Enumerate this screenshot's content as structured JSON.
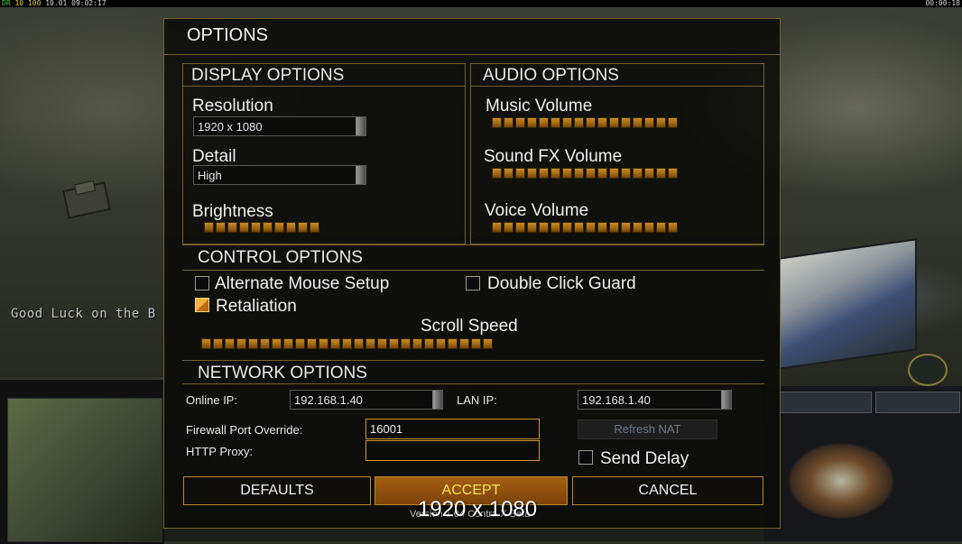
{
  "hud": {
    "fps_parts": [
      "DR",
      "10",
      "100",
      "10.01",
      "09:02:17"
    ],
    "timer": "00:00:18",
    "chat_message": "Good Luck on the B"
  },
  "options": {
    "title": "OPTIONS",
    "display": {
      "title": "DISPLAY OPTIONS",
      "resolution_label": "Resolution",
      "resolution_value": "1920 x 1080",
      "detail_label": "Detail",
      "detail_value": "High",
      "brightness_label": "Brightness",
      "brightness_level": 10
    },
    "audio": {
      "title": "AUDIO OPTIONS",
      "music_label": "Music Volume",
      "music_level": 16,
      "sfx_label": "Sound FX Volume",
      "sfx_level": 16,
      "voice_label": "Voice Volume",
      "voice_level": 16
    },
    "control": {
      "title": "CONTROL OPTIONS",
      "alt_mouse_label": "Alternate Mouse Setup",
      "alt_mouse_checked": false,
      "double_click_label": "Double Click Guard",
      "double_click_checked": false,
      "retaliation_label": "Retaliation",
      "retaliation_checked": true,
      "scroll_speed_label": "Scroll Speed",
      "scroll_speed_level": 25
    },
    "network": {
      "title": "NETWORK OPTIONS",
      "online_ip_label": "Online IP:",
      "online_ip_value": "192.168.1.40",
      "lan_ip_label": "LAN IP:",
      "lan_ip_value": "192.168.1.40",
      "firewall_label": "Firewall Port Override:",
      "firewall_value": "16001",
      "http_proxy_label": "HTTP Proxy:",
      "http_proxy_value": "",
      "refresh_nat_label": "Refresh NAT",
      "send_delay_label": "Send Delay",
      "send_delay_checked": false
    },
    "buttons": {
      "defaults": "DEFAULTS",
      "accept": "ACCEPT",
      "cancel": "CANCEL"
    },
    "version_text": "Version 1.04 Contra X Beta",
    "resolution_overlay": "1920 x 1080"
  },
  "colors": {
    "border": "#74612a",
    "slider": "#c98d22",
    "accent_button": "#a45e12",
    "accent_text": "#f6e35a"
  }
}
